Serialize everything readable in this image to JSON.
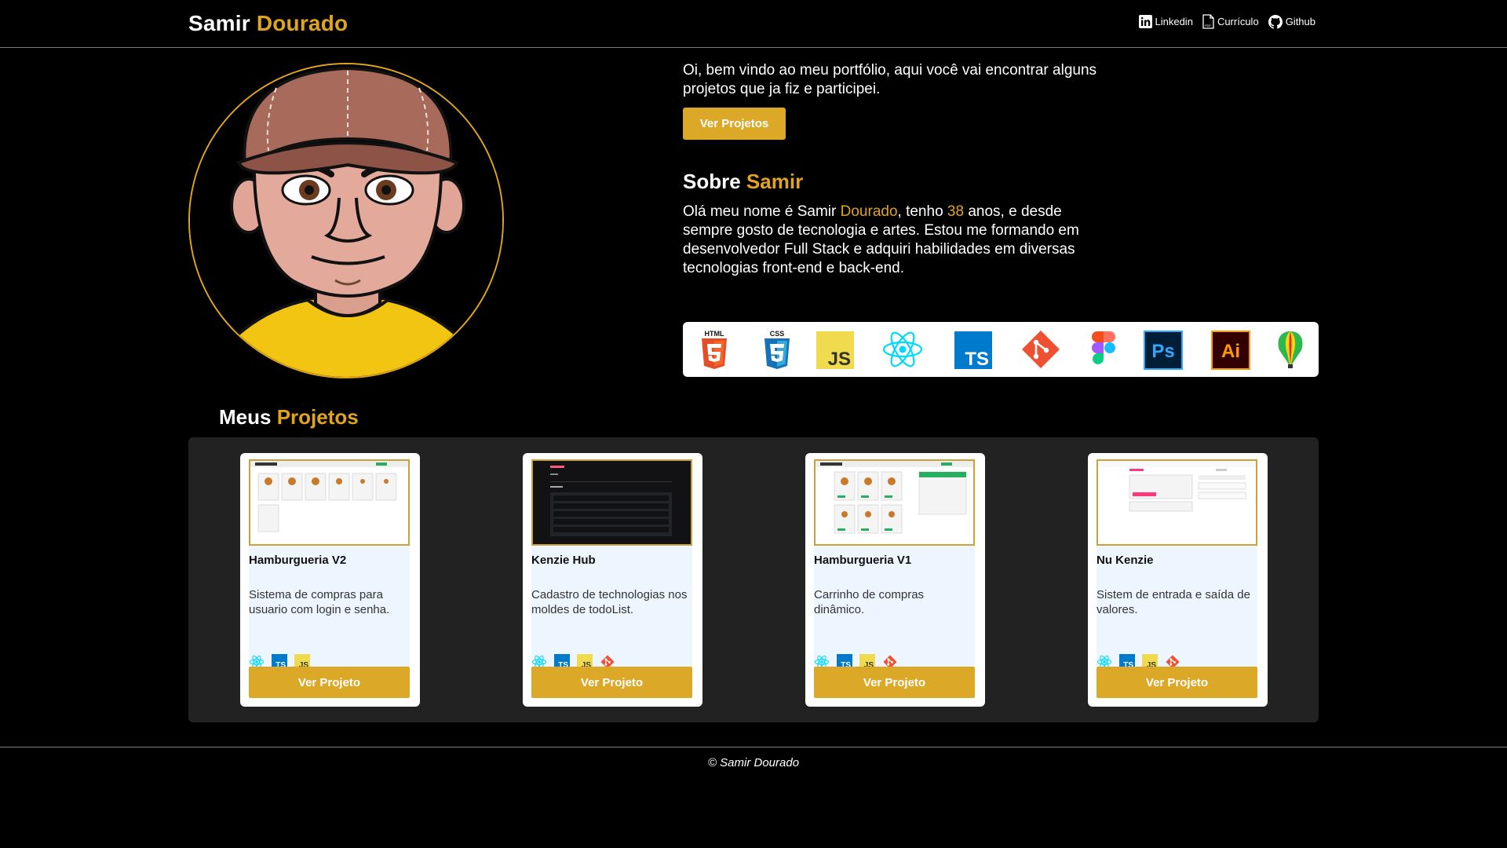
{
  "header": {
    "brand_first": "Samir",
    "brand_last": "Dourado",
    "nav": [
      {
        "label": "Linkedin",
        "icon": "linkedin-icon"
      },
      {
        "label": "Currículo",
        "icon": "pdf-file-icon"
      },
      {
        "label": "Github",
        "icon": "github-icon"
      }
    ]
  },
  "hero": {
    "intro": "Oi, bem vindo ao meu portfólio, aqui você vai encontrar alguns projetos que ja fiz e participei.",
    "cta": "Ver Projetos"
  },
  "about": {
    "title_first": "Sobre",
    "title_accent": "Samir",
    "text_1": "Olá meu nome é Samir ",
    "text_accent_1": "Dourado",
    "text_2": ", tenho ",
    "text_accent_2": "38",
    "text_3": " anos, e desde sempre gosto de tecnologia e artes. Estou me formando em desenvolvedor Full Stack e adquiri habilidades em diversas tecnologias front-end e back-end."
  },
  "tech_stack": [
    {
      "icon": "html5-icon",
      "label": "HTML"
    },
    {
      "icon": "css3-icon",
      "label": "CSS"
    },
    {
      "icon": "javascript-icon",
      "label": "JS"
    },
    {
      "icon": "react-icon"
    },
    {
      "icon": "typescript-icon",
      "label": "TS"
    },
    {
      "icon": "git-icon"
    },
    {
      "icon": "figma-icon"
    },
    {
      "icon": "photoshop-icon",
      "label": "Ps"
    },
    {
      "icon": "illustrator-icon",
      "label": "Ai"
    },
    {
      "icon": "coreldraw-icon"
    }
  ],
  "projects": {
    "title_first": "Meus",
    "title_accent": "Projetos",
    "button_label": "Ver Projeto",
    "items": [
      {
        "title": "Hamburgueria V2",
        "description": "Sistema de compras para usuario com login e senha.",
        "techs": [
          "react-icon",
          "typescript-icon",
          "javascript-icon"
        ]
      },
      {
        "title": "Kenzie Hub",
        "description": "Cadastro de technologias nos moldes de todoList.",
        "techs": [
          "react-icon",
          "typescript-icon",
          "javascript-icon",
          "git-icon"
        ]
      },
      {
        "title": "Hamburgueria V1",
        "description": "Carrinho de compras dinâmico.",
        "techs": [
          "react-icon",
          "typescript-icon",
          "javascript-icon",
          "git-icon"
        ]
      },
      {
        "title": "Nu Kenzie",
        "description": "Sistem de entrada e saída de valores.",
        "techs": [
          "react-icon",
          "typescript-icon",
          "javascript-icon",
          "git-icon"
        ]
      }
    ]
  },
  "footer": {
    "text": "© Samir Dourado"
  },
  "colors": {
    "accent": "#e0a41f",
    "button": "#dba828",
    "panel": "#222222",
    "card_inner": "#edf5ff"
  }
}
